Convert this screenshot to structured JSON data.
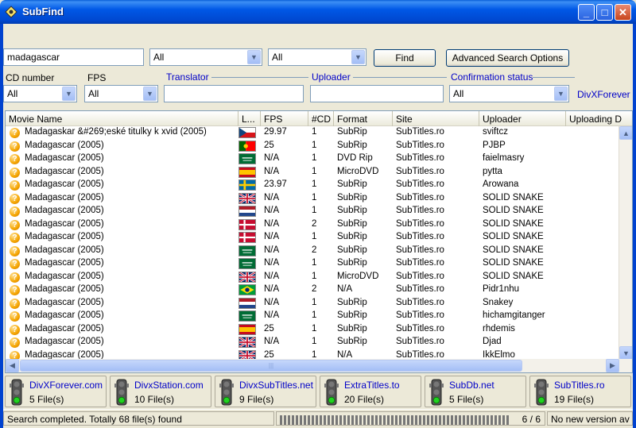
{
  "window": {
    "title": "SubFind",
    "minimize_icon": "minimize-icon",
    "maximize_icon": "maximize-icon",
    "close_icon": "close-icon",
    "min_glyph": "_",
    "max_glyph": "□",
    "close_glyph": "✕"
  },
  "search": {
    "query": "madagascar",
    "language1": "All",
    "language2": "All",
    "find_label": "Find",
    "advanced_label": "Advanced Search Options"
  },
  "filters": {
    "cd_label": "CD number",
    "cd_value": "All",
    "fps_label": "FPS",
    "fps_value": "All",
    "translator_label": "Translator",
    "translator_value": "",
    "uploader_label": "Uploader",
    "uploader_value": "",
    "confirmation_label": "Confirmation status",
    "confirmation_value": "All",
    "extra_group": "DivXForever"
  },
  "grid": {
    "columns": [
      "Movie Name",
      "L...",
      "FPS",
      "#CD",
      "Format",
      "Site",
      "Uploader",
      "Uploading D"
    ],
    "rows": [
      {
        "name": "Madagaskar &#269;eské titulky k xvid (2005)",
        "flag": "cz",
        "fps": "29.97",
        "cd": "1",
        "format": "SubRip",
        "site": "SubTitles.ro",
        "uploader": "sviftcz"
      },
      {
        "name": "Madagascar (2005)",
        "flag": "pt",
        "fps": "25",
        "cd": "1",
        "format": "SubRip",
        "site": "SubTitles.ro",
        "uploader": "PJBP"
      },
      {
        "name": "Madagascar (2005)",
        "flag": "sa",
        "fps": "N/A",
        "cd": "1",
        "format": "DVD Rip",
        "site": "SubTitles.ro",
        "uploader": "faielmasry"
      },
      {
        "name": "Madagascar (2005)",
        "flag": "es",
        "fps": "N/A",
        "cd": "1",
        "format": "MicroDVD",
        "site": "SubTitles.ro",
        "uploader": "pytta"
      },
      {
        "name": "Madagascar (2005)",
        "flag": "se",
        "fps": "23.97",
        "cd": "1",
        "format": "SubRip",
        "site": "SubTitles.ro",
        "uploader": "Arowana"
      },
      {
        "name": "Madagascar (2005)",
        "flag": "gb",
        "fps": "N/A",
        "cd": "1",
        "format": "SubRip",
        "site": "SubTitles.ro",
        "uploader": "SOLID SNAKE"
      },
      {
        "name": "Madagascar (2005)",
        "flag": "nl",
        "fps": "N/A",
        "cd": "1",
        "format": "SubRip",
        "site": "SubTitles.ro",
        "uploader": "SOLID SNAKE"
      },
      {
        "name": "Madagascar (2005)",
        "flag": "dk",
        "fps": "N/A",
        "cd": "2",
        "format": "SubRip",
        "site": "SubTitles.ro",
        "uploader": "SOLID SNAKE"
      },
      {
        "name": "Madagascar (2005)",
        "flag": "dk",
        "fps": "N/A",
        "cd": "1",
        "format": "SubRip",
        "site": "SubTitles.ro",
        "uploader": "SOLID SNAKE"
      },
      {
        "name": "Madagascar (2005)",
        "flag": "sa",
        "fps": "N/A",
        "cd": "2",
        "format": "SubRip",
        "site": "SubTitles.ro",
        "uploader": "SOLID SNAKE"
      },
      {
        "name": "Madagascar (2005)",
        "flag": "sa",
        "fps": "N/A",
        "cd": "1",
        "format": "SubRip",
        "site": "SubTitles.ro",
        "uploader": "SOLID SNAKE"
      },
      {
        "name": "Madagascar (2005)",
        "flag": "gb",
        "fps": "N/A",
        "cd": "1",
        "format": "MicroDVD",
        "site": "SubTitles.ro",
        "uploader": "SOLID SNAKE"
      },
      {
        "name": "Madagascar (2005)",
        "flag": "br",
        "fps": "N/A",
        "cd": "2",
        "format": "N/A",
        "site": "SubTitles.ro",
        "uploader": "Pidr1nhu"
      },
      {
        "name": "Madagascar (2005)",
        "flag": "nl",
        "fps": "N/A",
        "cd": "1",
        "format": "SubRip",
        "site": "SubTitles.ro",
        "uploader": "Snakey"
      },
      {
        "name": "Madagascar (2005)",
        "flag": "sa",
        "fps": "N/A",
        "cd": "1",
        "format": "SubRip",
        "site": "SubTitles.ro",
        "uploader": "hichamgitanger"
      },
      {
        "name": "Madagascar (2005)",
        "flag": "es",
        "fps": "25",
        "cd": "1",
        "format": "SubRip",
        "site": "SubTitles.ro",
        "uploader": "rhdemis"
      },
      {
        "name": "Madagascar (2005)",
        "flag": "gb",
        "fps": "N/A",
        "cd": "1",
        "format": "SubRip",
        "site": "SubTitles.ro",
        "uploader": "Djad"
      },
      {
        "name": "Madagascar (2005)",
        "flag": "gb",
        "fps": "25",
        "cd": "1",
        "format": "N/A",
        "site": "SubTitles.ro",
        "uploader": "IkkElmo"
      }
    ]
  },
  "sites": [
    {
      "name": "DivXForever.com",
      "count": "5 File(s)"
    },
    {
      "name": "DivxStation.com",
      "count": "10 File(s)"
    },
    {
      "name": "DivxSubTitles.net",
      "count": "9 File(s)"
    },
    {
      "name": "ExtraTitles.to",
      "count": "20 File(s)"
    },
    {
      "name": "SubDb.net",
      "count": "5 File(s)"
    },
    {
      "name": "SubTitles.ro",
      "count": "19 File(s)"
    }
  ],
  "status": {
    "message": "Search completed. Totally 68 file(s) found",
    "progress": 1.0,
    "counter": "6 / 6",
    "version": "No new version av"
  },
  "colors": {
    "link": "#0000c8",
    "titlebar": "#0058e6"
  }
}
